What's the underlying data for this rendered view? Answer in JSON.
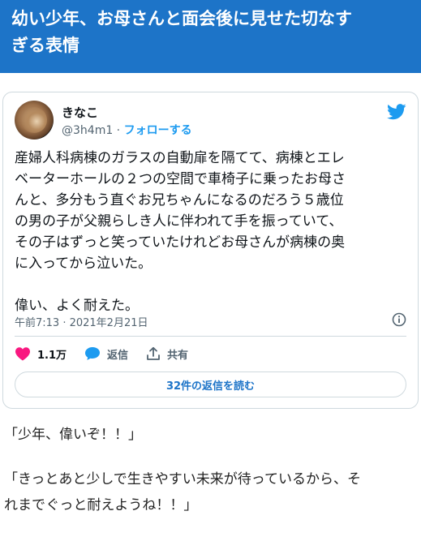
{
  "headline": {
    "line1": "幼い少年、お母さんと面会後に見せた切なす",
    "line2": "ぎる表情"
  },
  "tweet": {
    "author_name": "きなこ",
    "handle": "@3h4m1",
    "separator": " · ",
    "follow_label": "フォローする",
    "body_lines": [
      "産婦人科病棟のガラスの自動扉を隔てて、病棟とエレ",
      "ベーターホールの２つの空間で車椅子に乗ったお母さ",
      "んと、多分もう直ぐお兄ちゃんになるのだろう５歳位",
      "の男の子が父親らしき人に伴われて手を振っていて、",
      "その子はずっと笑っていたけれどお母さんが病棟の奥",
      "に入ってから泣いた。"
    ],
    "body_last": "偉い、よく耐えた。",
    "timestamp": "午前7:13 · 2021年2月21日",
    "likes": "1.1万",
    "reply_label": "返信",
    "share_label": "共有",
    "read_replies": "32件の返信を読む",
    "colors": {
      "like": "#f91880",
      "reply_bubble": "#1d9bf0",
      "twitter_blue": "#1d9bf0"
    },
    "icons": [
      "twitter-bird-icon",
      "info-icon",
      "heart-icon",
      "reply-bubble-icon",
      "share-icon"
    ]
  },
  "captions": {
    "line1": "「少年、偉いぞ！！」",
    "line2a": "「きっとあと少しで生きやすい未来が待っているから、そ",
    "line2b": "れまでぐっと耐えようね！！」"
  }
}
